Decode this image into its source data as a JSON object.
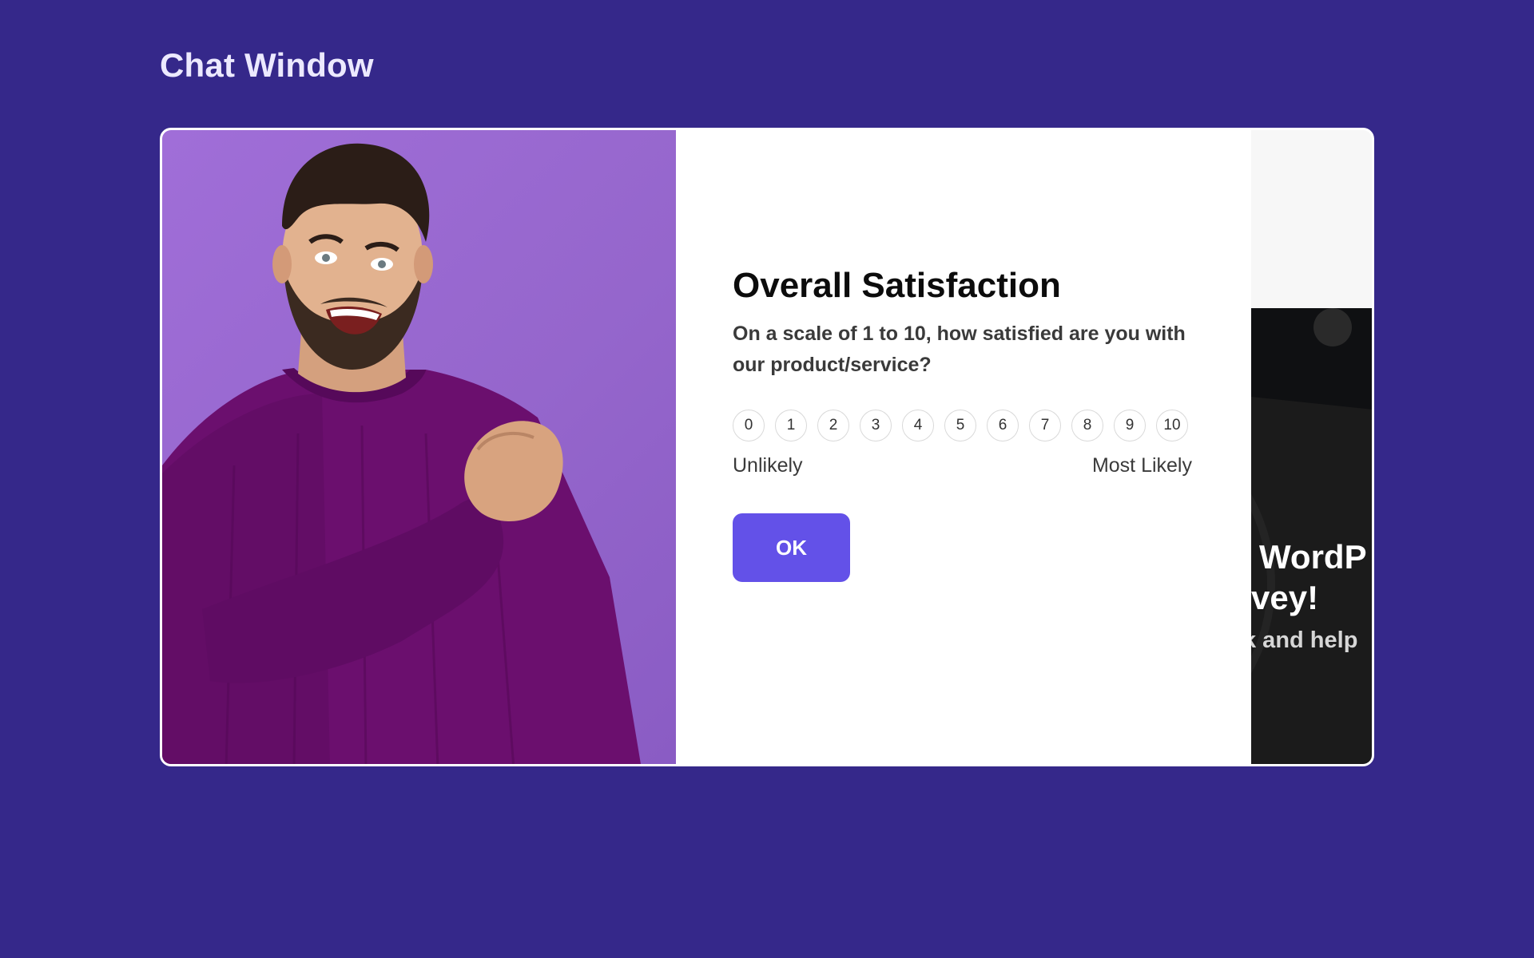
{
  "page": {
    "heading": "Chat Window"
  },
  "survey": {
    "title": "Overall Satisfaction",
    "question": "On a scale of 1 to 10, how satisfied are you with our product/service?",
    "scale_options": [
      "0",
      "1",
      "2",
      "3",
      "4",
      "5",
      "6",
      "7",
      "8",
      "9",
      "10"
    ],
    "low_label": "Unlikely",
    "high_label": "Most Likely",
    "ok_label": "OK"
  },
  "preview": {
    "headline_line1": "e WordP",
    "headline_line2": "vey!",
    "subtext": "k and help"
  },
  "colors": {
    "background": "#35288a",
    "accent_button": "#6351e8",
    "photo_background": "#9566cc",
    "sweater": "#6b0f6e"
  },
  "icons": {
    "photo": "smiling-man-photo"
  }
}
